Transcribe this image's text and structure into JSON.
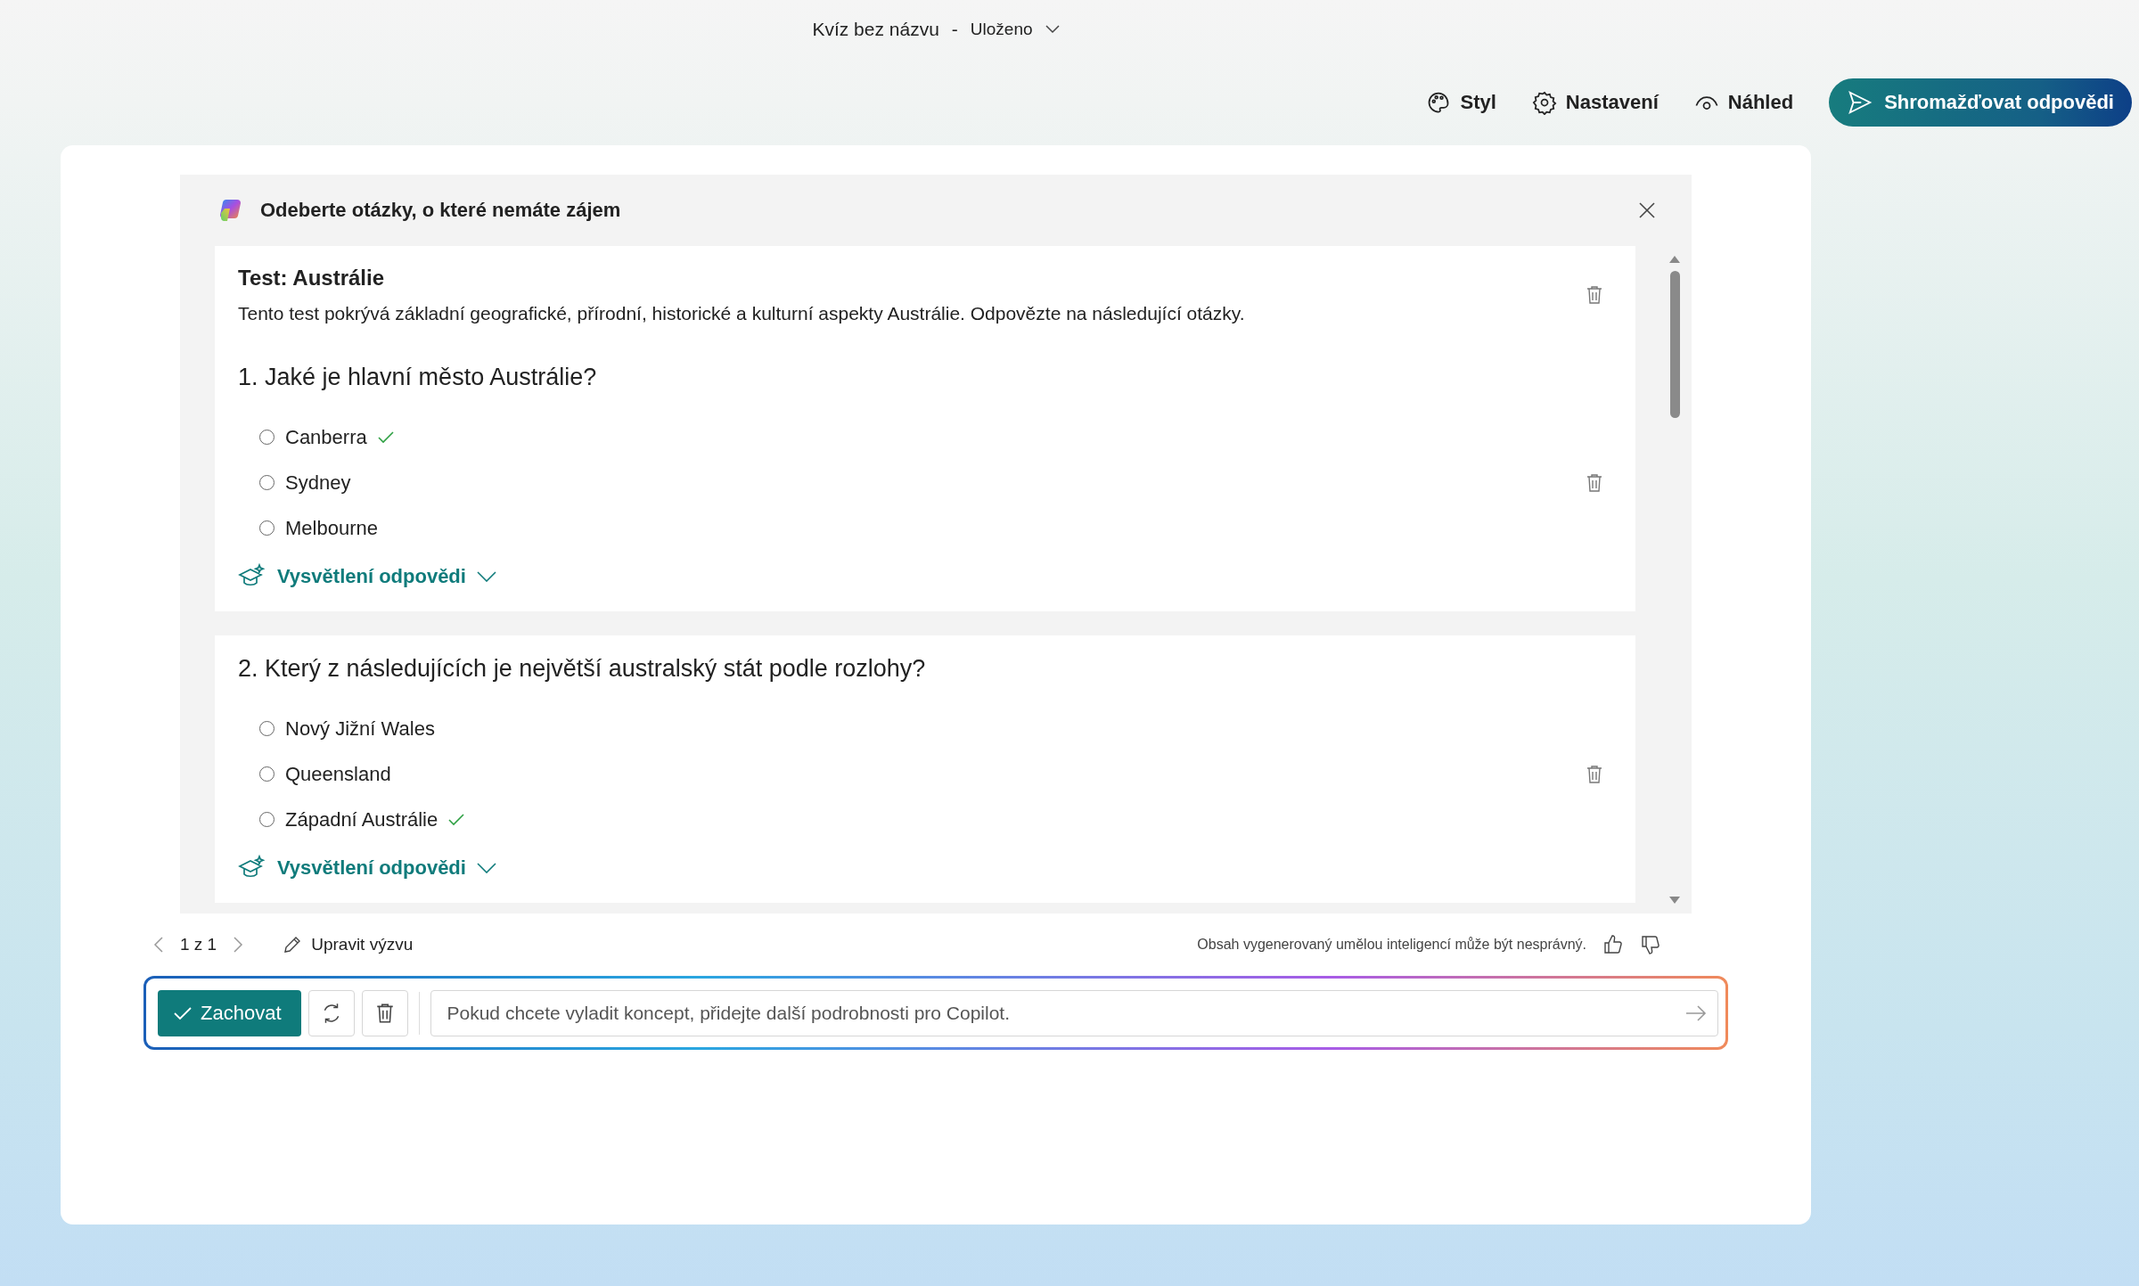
{
  "header": {
    "title": "Kvíz bez názvu",
    "separator": "-",
    "status": "Uloženo"
  },
  "toolbar": [
    {
      "kind": "style",
      "label": "Styl"
    },
    {
      "kind": "settings",
      "label": "Nastavení"
    },
    {
      "kind": "preview",
      "label": "Náhled"
    }
  ],
  "primary_button": "Shromažďovat odpovědi",
  "copilot_panel": {
    "title": "Odeberte otázky, o které nemáte zájem",
    "quiz_title": "Test: Austrálie",
    "quiz_description": "Tento test pokrývá základní geografické, přírodní, historické a kulturní aspekty Austrálie. Odpovězte na následující otázky.",
    "questions": [
      {
        "text": "1. Jaké je hlavní město Austrálie?",
        "explanation_link": "Vysvětlení odpovědi",
        "options": [
          {
            "label": "Canberra",
            "correct": true,
            "selected": false
          },
          {
            "label": "Sydney",
            "correct": false,
            "selected": false
          },
          {
            "label": "Melbourne",
            "correct": false,
            "selected": false
          }
        ]
      },
      {
        "text": "2. Který z následujících je největší australský stát podle rozlohy?",
        "explanation_link": "Vysvětlení odpovědi",
        "options": [
          {
            "label": "Nový Jižní Wales",
            "correct": false,
            "selected": false
          },
          {
            "label": "Queensland",
            "correct": false,
            "selected": false
          },
          {
            "label": "Západní Austrálie",
            "correct": true,
            "selected": false
          }
        ]
      }
    ]
  },
  "pager": {
    "text": "1 z 1",
    "edit_prompt": "Upravit výzvu",
    "disclaimer": "Obsah vygenerovaný umělou inteligencí může být nesprávný."
  },
  "composer": {
    "keep_button": "Zachovat",
    "placeholder": "Pokud chcete vyladit koncept, přidejte další podrobnosti pro Copilot."
  }
}
